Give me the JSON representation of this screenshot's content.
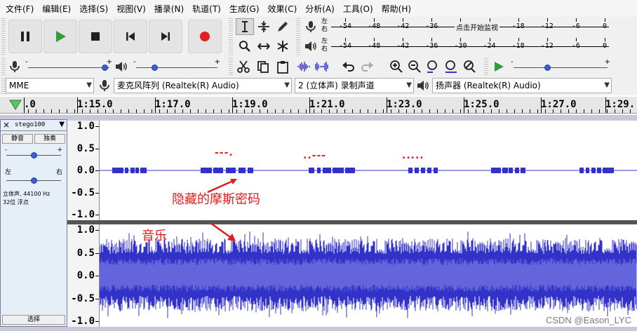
{
  "menu": [
    "文件(F)",
    "编辑(E)",
    "选择(S)",
    "视图(V)",
    "播录(N)",
    "轨道(T)",
    "生成(G)",
    "效果(C)",
    "分析(A)",
    "工具(O)",
    "帮助(H)"
  ],
  "meters": {
    "channel_labels": [
      "左",
      "右"
    ],
    "record_ticks": [
      "-54",
      "-48",
      "-42",
      "-36",
      "-30",
      "-24",
      "-18",
      "-12",
      "-6",
      "0"
    ],
    "record_hint": "点击开始监视",
    "play_ticks": [
      "-54",
      "-48",
      "-42",
      "-36",
      "-30",
      "-24",
      "-18",
      "-12",
      "-6",
      "0"
    ],
    "minus": "-",
    "plus": "+"
  },
  "sliders": {
    "record_volume_level": 0.97,
    "playback_volume_level": 0.2,
    "playback_speed_level": 0.35
  },
  "devices": {
    "host": "MME",
    "recording_device": "麦克风阵列 (Realtek(R) Audio)",
    "channels": "2 (立体声) 录制声道",
    "playback_device": "扬声器 (Realtek(R) Audio)"
  },
  "timeline": {
    "labels": [
      ".0",
      "1:15.0",
      "1:17.0",
      "1:19.0",
      "1:21.0",
      "1:23.0",
      "1:25.0",
      "1:27.0",
      "1:29."
    ]
  },
  "track": {
    "name": "stego100",
    "close": "×",
    "menu_arrow": "▼",
    "mute": "静音",
    "solo": "独奏",
    "gain_minus": "-",
    "gain_plus": "+",
    "pan_left": "左",
    "pan_right": "右",
    "info_line1": "立体声, 44100 Hz",
    "info_line2": "32位 浮点",
    "select": "选择",
    "gain_level": 0.5,
    "pan_level": 0.5
  },
  "scale_labels": [
    "1.0",
    "0.5",
    "0.0",
    "-0.5",
    "-1.0"
  ],
  "annotations": {
    "morse_label": "隐藏的摩斯密码",
    "music_label": "音乐",
    "morse_marks": [
      "---.",
      "..---",
      "....."
    ]
  },
  "colors": {
    "waveform": "#3232c8",
    "waveform_rms": "#6464dc",
    "annotation": "#e21b1b",
    "play_green": "#2f9e3a",
    "record_red": "#e02020"
  },
  "watermark": "CSDN @Eason_LYC"
}
